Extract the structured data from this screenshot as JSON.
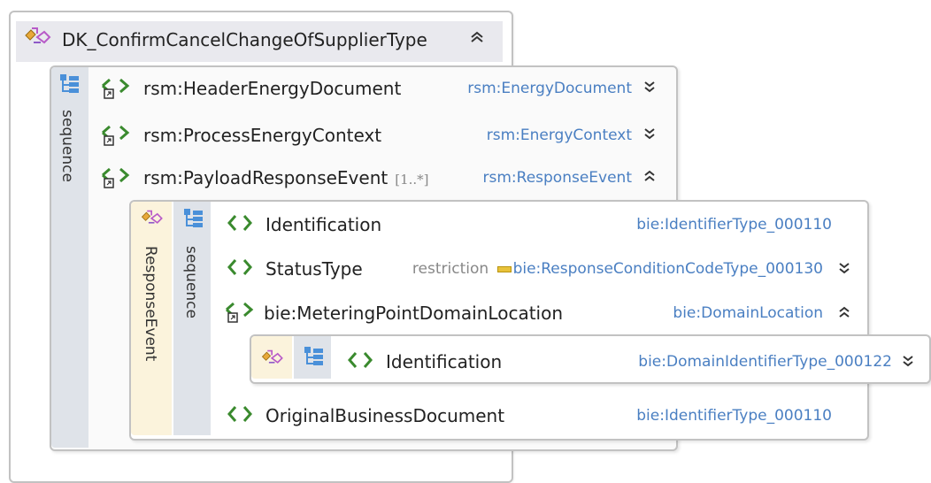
{
  "outer": {
    "title": "DK_ConfirmCancelChangeOfSupplierType",
    "chevron": "»"
  },
  "sequence1": {
    "label": "sequence",
    "rows": [
      {
        "name": "rsm:HeaderEnergyDocument",
        "type": "rsm:EnergyDocument",
        "multiplicity": "",
        "expanded": false
      },
      {
        "name": "rsm:ProcessEnergyContext",
        "type": "rsm:EnergyContext",
        "multiplicity": "",
        "expanded": false
      },
      {
        "name": "rsm:PayloadResponseEvent",
        "type": "rsm:ResponseEvent",
        "multiplicity": "[1..*]",
        "expanded": true
      }
    ]
  },
  "response_event": {
    "label": "ResponseEvent",
    "sequence_label": "sequence",
    "rows": [
      {
        "name": "Identification",
        "type": "bie:IdentifierType_000110"
      },
      {
        "name": "StatusType",
        "restriction": "restriction",
        "type": "bie:ResponseConditionCodeType_000130"
      },
      {
        "name": "bie:MeteringPointDomainLocation",
        "type": "bie:DomainLocation"
      },
      {
        "name": "OriginalBusinessDocument",
        "type": "bie:IdentifierType_000110"
      }
    ],
    "inner": {
      "name": "Identification",
      "type": "bie:DomainIdentifierType_000122"
    }
  },
  "colors": {
    "type_text": "#4a7fc2",
    "sequence_strip": "#dfe3e9",
    "complex_strip": "#fbf3dc",
    "header_bg": "#e9e9ee",
    "element_icon": "#3a8a2e"
  }
}
